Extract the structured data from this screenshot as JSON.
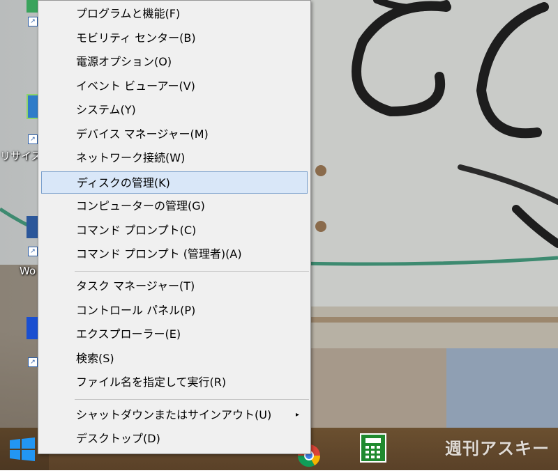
{
  "menu": {
    "items": [
      {
        "label": "プログラムと機能(F)"
      },
      {
        "label": "モビリティ センター(B)"
      },
      {
        "label": "電源オプション(O)"
      },
      {
        "label": "イベント ビューアー(V)"
      },
      {
        "label": "システム(Y)"
      },
      {
        "label": "デバイス マネージャー(M)"
      },
      {
        "label": "ネットワーク接続(W)"
      },
      {
        "label": "ディスクの管理(K)",
        "highlighted": true
      },
      {
        "label": "コンピューターの管理(G)"
      },
      {
        "label": "コマンド プロンプト(C)"
      },
      {
        "label": "コマンド プロンプト (管理者)(A)"
      },
      {
        "label": "タスク マネージャー(T)"
      },
      {
        "label": "コントロール パネル(P)"
      },
      {
        "label": "エクスプローラー(E)"
      },
      {
        "label": "検索(S)"
      },
      {
        "label": "ファイル名を指定して実行(R)"
      },
      {
        "label": "シャットダウンまたはサインアウト(U)",
        "has_submenu": true
      },
      {
        "label": "デスクトップ(D)"
      }
    ],
    "submenu_arrow": "▸"
  },
  "desktop": {
    "icons": [
      {
        "label": "リサイス"
      },
      {
        "label": "Wo"
      }
    ]
  },
  "watermark": "週刊アスキー",
  "colors": {
    "menu_bg": "#f0f0f0",
    "highlight_bg": "#d9e7f8",
    "highlight_border": "#7da2ce",
    "taskbar": "#5f452b",
    "start_blue": "#1e90e8",
    "calc_green": "#1f8a2f"
  }
}
